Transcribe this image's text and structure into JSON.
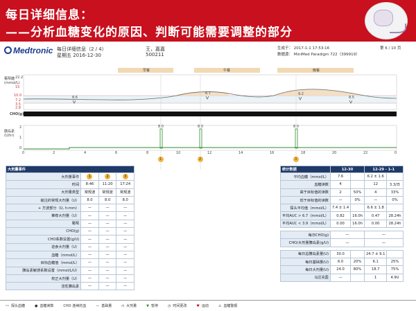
{
  "banner": {
    "title1": "每日详细信息：",
    "title2": "——分析血糖变化的原因、判断可能需要调整的部分"
  },
  "report": {
    "brand": "Medtronic",
    "page_title": "每日详细信息（2 / 4）",
    "date": "星期五  2016-12-30",
    "patient_name": "王，嘉嘉",
    "patient_id": "500211",
    "generated": "生成于：  2017-1-1   17:53:16",
    "page_num": "第 6 / 10 页",
    "device": "数据源：  MiniMed Paradigm 722（399919）"
  },
  "meals": [
    "早餐",
    "午餐",
    "晚餐"
  ],
  "glucose_chart": {
    "ylabel": "葡萄糖\n(mmol/L)",
    "yticks": [
      "22.2",
      "15",
      "10.0",
      "7.2",
      "3.5",
      "2.8"
    ],
    "markers": [
      "8.6",
      "6.7",
      "9.2",
      "8.5"
    ],
    "cho_label": "CHO(g)"
  },
  "insulin_chart": {
    "ylabel": "胰岛素\n(U/hr)",
    "yticks": [
      "2",
      "1",
      "0"
    ],
    "bolus_labels": [
      "8.0",
      "8.0",
      "8.0"
    ],
    "xticks": [
      "0",
      "2",
      "4",
      "6",
      "8",
      "10",
      "12",
      "14",
      "16",
      "18",
      "20",
      "22",
      "0"
    ],
    "events": [
      "1",
      "2",
      "3"
    ]
  },
  "bolus_table": {
    "header": "大剂量事件",
    "events_label": "大剂量事件",
    "events": [
      "1",
      "2",
      "3"
    ],
    "rows": [
      {
        "label": "时间",
        "values": [
          "8:46",
          "11:20",
          "17:24"
        ]
      },
      {
        "label": "大剂量类型",
        "values": [
          "常规波",
          "常规波",
          "常规波"
        ]
      },
      {
        "label": "输注的常规大剂量（U）",
        "values": [
          "8.0",
          "8.0",
          "8.0"
        ]
      },
      {
        "label": "+ 方波部分（U, h:mm）",
        "values": [
          "—",
          "—",
          "—"
        ]
      },
      {
        "label": "推荐大剂量（U）",
        "values": [
          "—",
          "—",
          "—"
        ]
      },
      {
        "label": "葡萄",
        "values": [
          "—",
          "—",
          "—"
        ]
      },
      {
        "label": "CHO(g)",
        "values": [
          "—",
          "—",
          "—"
        ]
      },
      {
        "label": "CHO系数设置(g/U)",
        "values": [
          "—",
          "—",
          "—"
        ]
      },
      {
        "label": "进食大剂量（U）",
        "values": [
          "—",
          "—",
          "—"
        ]
      },
      {
        "label": "血糖（mmol/L）",
        "values": [
          "—",
          "—",
          "—"
        ]
      },
      {
        "label": "目标血糖值（mmol/L）",
        "values": [
          "—",
          "—",
          "—"
        ]
      },
      {
        "label": "胰岛素敏感系数设置（mmol/L/U）",
        "values": [
          "—",
          "—",
          "—"
        ]
      },
      {
        "label": "校正大剂量（U）",
        "values": [
          "—",
          "—",
          "—"
        ]
      },
      {
        "label": "活性胰岛素",
        "values": [
          "—",
          "—",
          "—"
        ]
      }
    ]
  },
  "stats_table": {
    "header": "统计数据",
    "col1": "12-30",
    "col2": "12-29 - 1-1",
    "rows": [
      {
        "label": "平均血糖（mmol/L）",
        "a": "7.6",
        "a2": "",
        "b": "6.2 ± 1.6",
        "b2": ""
      },
      {
        "label": "血糖读数",
        "a": "4",
        "a2": "",
        "b": "12",
        "b2": "3.3/日"
      },
      {
        "label": "高于目标值的读数",
        "a": "2",
        "a2": "50%",
        "b": "4",
        "b2": "33%"
      },
      {
        "label": "低于目标值的读数",
        "a": "—",
        "a2": "0%",
        "b": "—",
        "b2": "0%"
      },
      {
        "label": "探头平均值（mmol/L）",
        "a": "7.4 ± 1.4",
        "a2": "",
        "b": "6.6 ± 1.8",
        "b2": ""
      },
      {
        "label": "平均AUC > 6.7（mmol/L）",
        "a": "0.82",
        "a2": "16.0h",
        "b": "0.47",
        "b2": "28.24h"
      },
      {
        "label": "平均AUC < 3.9（mmol/L）",
        "a": "0.00",
        "a2": "16.0h",
        "b": "0.00",
        "b2": "28.24h"
      }
    ],
    "cho_rows": [
      {
        "label": "每日CHO(g)",
        "a": "—",
        "b": "—"
      },
      {
        "label": "CHO/大剂量胰岛素(g/U)",
        "a": "—",
        "b": "—"
      }
    ],
    "insulin_rows": [
      {
        "label": "每日总胰岛素量(U)",
        "a": "30.0",
        "a2": "",
        "b": "24.7 ± 9.1",
        "b2": ""
      },
      {
        "label": "每日基础量(U)",
        "a": "6.0",
        "a2": "20%",
        "b": "6.1",
        "b2": "25%"
      },
      {
        "label": "每日大剂量(U)",
        "a": "24.0",
        "a2": "80%",
        "b": "18.7",
        "b2": "75%"
      },
      {
        "label": "马达充盈",
        "a": "—",
        "a2": "",
        "b": "1",
        "b2": "4.9U"
      }
    ]
  },
  "legend": [
    "探头血糖",
    "血糖读数",
    "CHO 连续的血",
    "基础量",
    "大剂量",
    "暂停",
    "时间更改",
    "运动",
    "血糖警报"
  ]
}
